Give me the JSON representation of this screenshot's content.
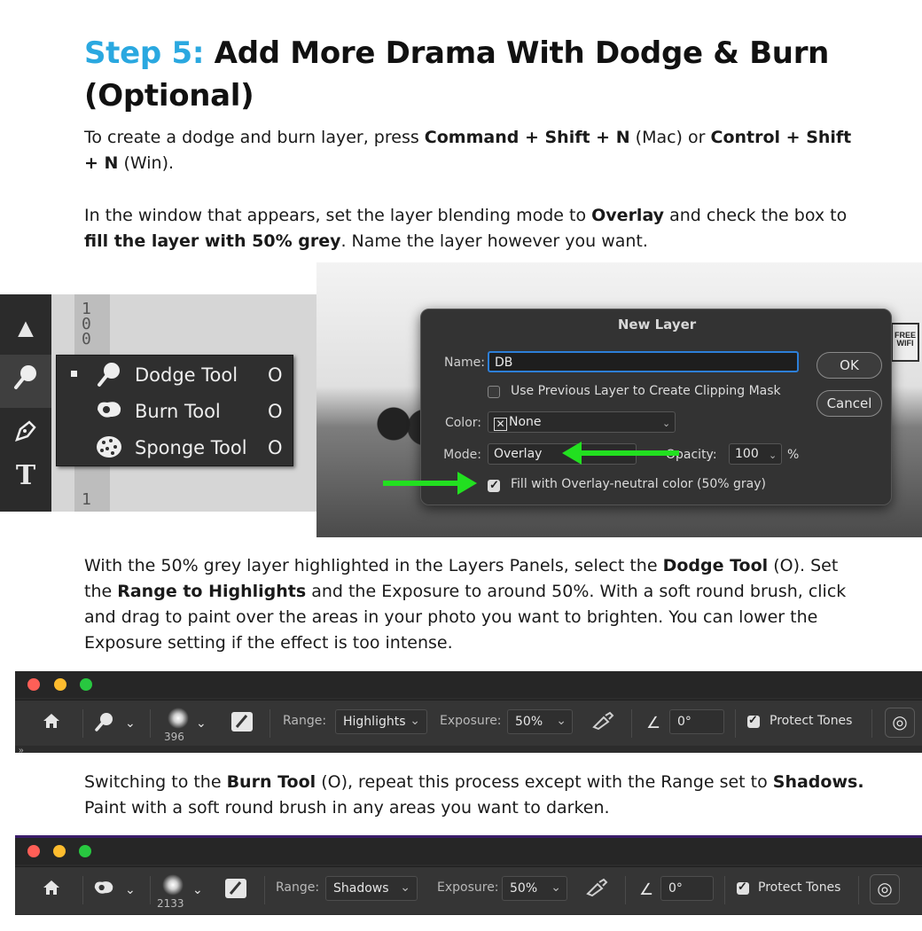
{
  "heading": {
    "step": "Step 5:",
    "title": " Add More Drama With Dodge & Burn (Optional)"
  },
  "para1": {
    "t1": "To create a dodge and burn layer, press ",
    "b1": "Command + Shift + N",
    "t2": " (Mac) or ",
    "b2": "Control + Shift + N",
    "t3": " (Win)."
  },
  "para2": {
    "t1": "In the window that appears, set the layer blending mode to ",
    "b1": "Overlay",
    "t2": " and check the box to ",
    "b2": "fill the layer with 50% grey",
    "t3": ". Name the layer however you want."
  },
  "flyout": {
    "ruler": [
      "1",
      "0",
      "0"
    ],
    "ruler_bottom": "1",
    "items": [
      {
        "label": "Dodge Tool",
        "key": "O"
      },
      {
        "label": "Burn Tool",
        "key": "O"
      },
      {
        "label": "Sponge Tool",
        "key": "O"
      }
    ]
  },
  "dialog": {
    "sign": "FREE WIFI",
    "title": "New Layer",
    "name_label": "Name:",
    "name_value": "DB",
    "clip_label": "Use Previous Layer to Create Clipping Mask",
    "color_label": "Color:",
    "color_value": "None",
    "mode_label": "Mode:",
    "mode_value": "Overlay",
    "opacity_label": "Opacity:",
    "opacity_value": "100",
    "opacity_unit": "%",
    "fill_label": "Fill with Overlay-neutral color (50% gray)",
    "ok": "OK",
    "cancel": "Cancel"
  },
  "para3": {
    "t1": "With the 50% grey layer highlighted in the Layers Panels, select the ",
    "b1": "Dodge Tool",
    "t2": " (O). Set the ",
    "b2": "Range to Highlights",
    "t3": " and the Exposure to around 50%. With a soft round brush, click and drag to paint over the areas in your photo you want to brighten. You can lower the Exposure setting if the effect is too intense."
  },
  "bar1": {
    "brush_size": "396",
    "range_label": "Range:",
    "range_value": "Highlights",
    "exposure_label": "Exposure:",
    "exposure_value": "50%",
    "angle_value": "0°",
    "protect_label": "Protect Tones",
    "overflow": "»"
  },
  "para4": {
    "t1": "Switching to the ",
    "b1": "Burn Tool",
    "t2": " (O), repeat this process except with the Range set to ",
    "b2": "Shadows.",
    "t3": " Paint with a soft round brush in any areas you want to darken."
  },
  "bar2": {
    "brush_size": "2133",
    "range_label": "Range:",
    "range_value": "Shadows",
    "exposure_label": "Exposure:",
    "exposure_value": "50%",
    "angle_value": "0°",
    "protect_label": "Protect Tones"
  },
  "colors": {
    "accent": "#2aa8e0",
    "arrow": "#22e020",
    "mac_red": "#ff5f57",
    "mac_yellow": "#febc2e",
    "mac_green": "#28c840"
  }
}
